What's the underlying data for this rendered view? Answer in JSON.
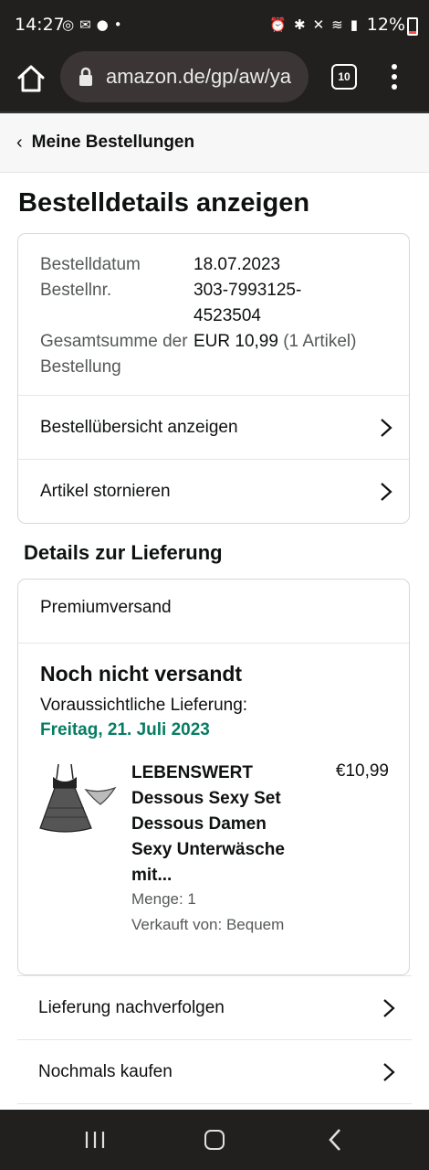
{
  "status_bar": {
    "time": "14:27",
    "battery": "12%",
    "left_icons": [
      "search-notif-icon",
      "mail-icon",
      "chat-icon",
      "dot-icon"
    ],
    "right_icons": [
      "alarm-icon",
      "bluetooth-icon",
      "mute-icon",
      "wifi-icon",
      "signal-icon"
    ]
  },
  "browser": {
    "url": "amazon.de/gp/aw/ya",
    "tab_count": "10"
  },
  "back_link": "Meine Bestellungen",
  "page_title": "Bestelldetails anzeigen",
  "order": {
    "date_label": "Bestelldatum",
    "date_value": "18.07.2023",
    "number_label": "Bestellnr.",
    "number_value": "303-7993125-4523504",
    "total_label": "Gesamtsumme der Bestellung",
    "total_value": "EUR 10,99",
    "total_items": "(1 Artikel)"
  },
  "order_links": {
    "overview": "Bestellübersicht anzeigen",
    "cancel": "Artikel stornieren"
  },
  "delivery_section_title": "Details zur Lieferung",
  "delivery": {
    "shipping_method": "Premiumversand",
    "status": "Noch nicht versandt",
    "expected_label": "Voraussichtliche Lieferung:",
    "expected_date": "Freitag, 21. Juli 2023",
    "date_color": "#067d62"
  },
  "product": {
    "title": "LEBENSWERT Dessous Sexy Set Dessous Damen Sexy Unterwäsche mit...",
    "price": "€10,99",
    "quantity": "Menge: 1",
    "seller": "Verkauft von: Bequem"
  },
  "actions": {
    "track": "Lieferung nachverfolgen",
    "buy_again": "Nochmals kaufen"
  }
}
